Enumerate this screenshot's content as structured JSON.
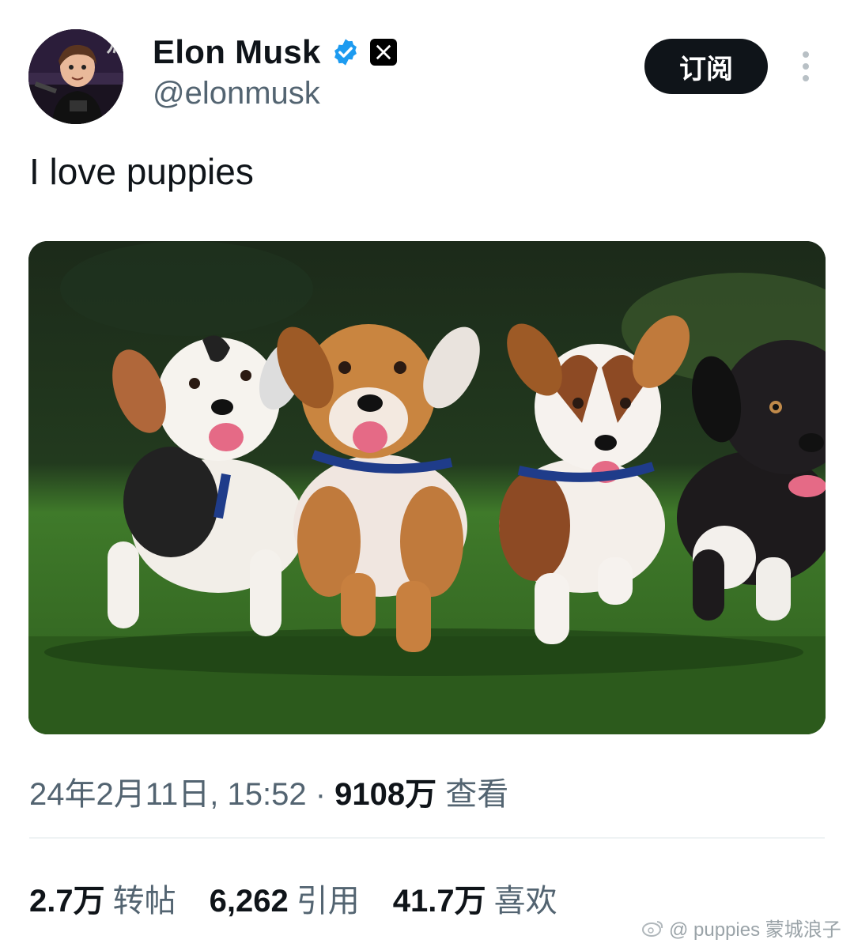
{
  "author": {
    "display_name": "Elon Musk",
    "handle": "@elonmusk",
    "avatar_icon": "avatar-cartoon-icon",
    "verified_icon": "verified-badge-icon",
    "badge_icon": "x-logo-icon"
  },
  "header": {
    "subscribe_label": "订阅",
    "more_icon": "more-vertical-icon"
  },
  "tweet": {
    "text": "I love puppies",
    "media_description": "puppies running on grass"
  },
  "meta": {
    "timestamp": "24年2月11日, 15:52",
    "separator": "·",
    "views_count": "9108万",
    "views_label": "查看"
  },
  "stats": [
    {
      "value": "2.7万",
      "label": "转帖"
    },
    {
      "value": "6,262",
      "label": "引用"
    },
    {
      "value": "41.7万",
      "label": "喜欢"
    }
  ],
  "watermark": {
    "text": "@ puppies  蒙城浪子",
    "icon": "weibo-icon"
  },
  "colors": {
    "primary_text": "#0f1419",
    "secondary_text": "#536471",
    "button_bg": "#0f1419",
    "verified_blue": "#1d9bf0"
  }
}
